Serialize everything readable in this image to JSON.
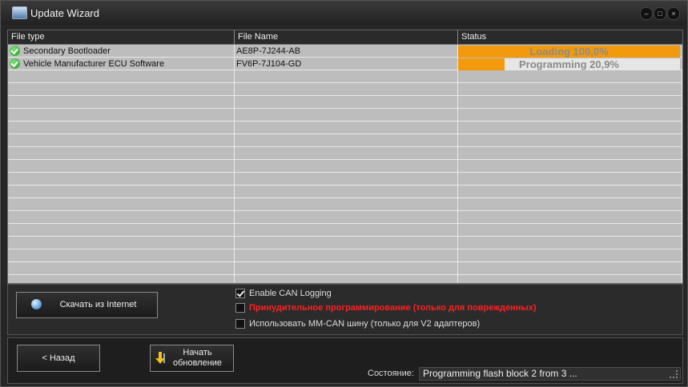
{
  "window": {
    "title": "Update Wizard",
    "controls": [
      "minimize",
      "maximize",
      "close"
    ]
  },
  "grid": {
    "columns": [
      "File type",
      "File Name",
      "Status"
    ],
    "rows": [
      {
        "type": "Secondary Bootloader",
        "file": "AE8P-7J244-AB",
        "status": "Loading 100,0%",
        "progress": 1.0
      },
      {
        "type": "Vehicle Manufacturer ECU Software",
        "file": "FV6P-7J104-GD",
        "status": "Programming 20,9%",
        "progress": 0.209
      }
    ],
    "colors": {
      "progress_fill": "#f39a0c",
      "row_bg": "#bdbdbd",
      "check": "#1f9a1f"
    }
  },
  "options": {
    "download_button": "Скачать из Internet",
    "can_logging": {
      "label": "Enable CAN Logging",
      "checked": true
    },
    "forced_programming": {
      "label": "Принудительное программирование (только для поврежденных)",
      "checked": false,
      "color": "#ff2020"
    },
    "mm_can": {
      "label": "Использовать MM-CAN шину (только для V2 адаптеров)",
      "checked": false
    }
  },
  "footer": {
    "back_button": "< Назад",
    "start_button_line1": "Начать",
    "start_button_line2": "обновление",
    "status_label": "Состояние:",
    "status_value": "Programming flash block 2 from 3 ..."
  }
}
